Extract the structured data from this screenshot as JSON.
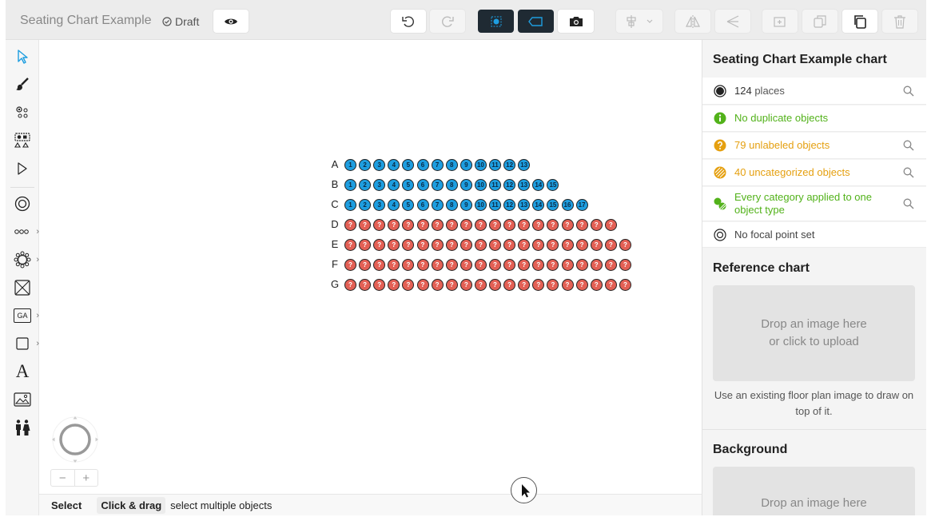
{
  "header": {
    "title": "Seating Chart Example",
    "draft_label": "Draft"
  },
  "toolbar": {
    "icons": [
      "eye-icon",
      "undo-icon",
      "redo-icon",
      "select-seats-icon",
      "label-tag-icon",
      "camera-icon",
      "align-icon",
      "flip-icon",
      "mirror-icon",
      "group-icon",
      "copy-icon",
      "paste-icon",
      "trash-icon"
    ]
  },
  "left_tools": [
    "pointer-icon",
    "brush-icon",
    "seat-select-icon",
    "table-shapes-icon",
    "node-icon",
    "focal-point-icon",
    "row-icon",
    "round-table-icon",
    "booth-icon",
    "general-admission-icon",
    "shape-icon",
    "text-icon",
    "image-icon",
    "restroom-icon"
  ],
  "left_tool_labels": {
    "ga": "GA",
    "text": "A"
  },
  "canvas": {
    "rows": [
      {
        "label": "A",
        "seats": [
          "1",
          "2",
          "3",
          "4",
          "5",
          "6",
          "7",
          "8",
          "9",
          "10",
          "11",
          "12",
          "13"
        ]
      },
      {
        "label": "B",
        "seats": [
          "1",
          "2",
          "3",
          "4",
          "5",
          "6",
          "7",
          "8",
          "9",
          "10",
          "11",
          "12",
          "13",
          "14",
          "15"
        ]
      },
      {
        "label": "C",
        "seats": [
          "1",
          "2",
          "3",
          "4",
          "5",
          "6",
          "7",
          "8",
          "9",
          "10",
          "11",
          "12",
          "13",
          "14",
          "15",
          "16",
          "17"
        ]
      },
      {
        "label": "D",
        "seats": [
          "?",
          "?",
          "?",
          "?",
          "?",
          "?",
          "?",
          "?",
          "?",
          "?",
          "?",
          "?",
          "?",
          "?",
          "?",
          "?",
          "?",
          "?",
          "?"
        ]
      },
      {
        "label": "E",
        "seats": [
          "?",
          "?",
          "?",
          "?",
          "?",
          "?",
          "?",
          "?",
          "?",
          "?",
          "?",
          "?",
          "?",
          "?",
          "?",
          "?",
          "?",
          "?",
          "?",
          "?"
        ]
      },
      {
        "label": "F",
        "seats": [
          "?",
          "?",
          "?",
          "?",
          "?",
          "?",
          "?",
          "?",
          "?",
          "?",
          "?",
          "?",
          "?",
          "?",
          "?",
          "?",
          "?",
          "?",
          "?",
          "?"
        ]
      },
      {
        "label": "G",
        "seats": [
          "?",
          "?",
          "?",
          "?",
          "?",
          "?",
          "?",
          "?",
          "?",
          "?",
          "?",
          "?",
          "?",
          "?",
          "?",
          "?",
          "?",
          "?",
          "?",
          "?"
        ]
      }
    ],
    "colors": {
      "labeled": "#1e9ee0",
      "unlabeled": "#e36055"
    }
  },
  "zoom": {
    "minus": "−",
    "plus": "+"
  },
  "status": {
    "mode": "Select",
    "key": "Click & drag",
    "description": "select multiple objects"
  },
  "panel": {
    "chart_title": "Seating Chart Example chart",
    "checks": {
      "places_count": "124",
      "places_text": "places",
      "duplicates": "No duplicate objects",
      "unlabeled_count": "79",
      "unlabeled_text": "unlabeled objects",
      "uncategorized_count": "40",
      "uncategorized_text": "uncategorized objects",
      "categories": "Every category applied to one object type",
      "focal": "No focal point set"
    },
    "reference": {
      "title": "Reference chart",
      "drop_line1": "Drop an image here",
      "drop_line2": "or click to upload",
      "hint": "Use an existing floor plan image to draw on top of it."
    },
    "background": {
      "title": "Background",
      "drop_line1": "Drop an image here"
    }
  }
}
